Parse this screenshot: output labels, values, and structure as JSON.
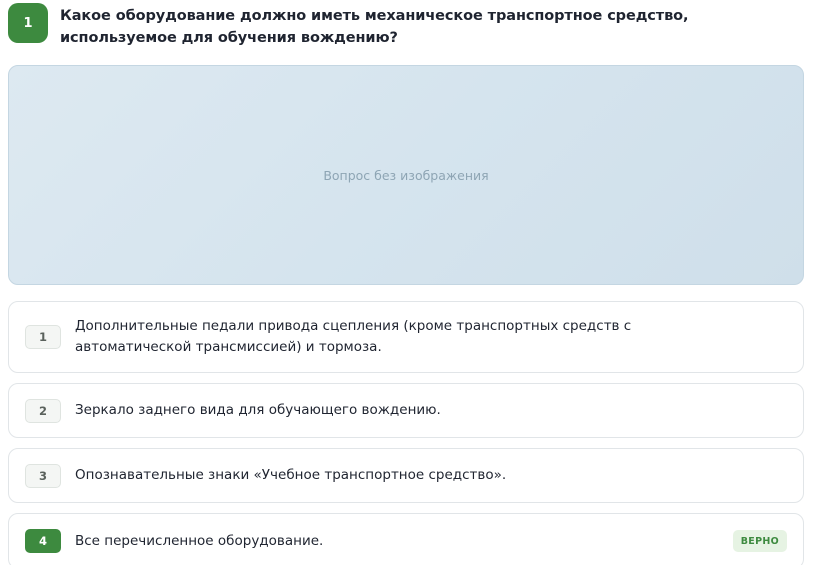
{
  "question": {
    "number": "1",
    "text": "Какое оборудование должно иметь механическое транспортное средство, используемое для обучения вождению?"
  },
  "image": {
    "placeholder": "Вопрос без изображения"
  },
  "answers": [
    {
      "number": "1",
      "text": "Дополнительные педали привода сцепления (кроме транспортных средств с автоматической трансмиссией) и тормоза."
    },
    {
      "number": "2",
      "text": "Зеркало заднего вида для обучающего вождению."
    },
    {
      "number": "3",
      "text": "Опознавательные знаки «Учебное транспортное средство»."
    },
    {
      "number": "4",
      "text": "Все перечисленное оборудование.",
      "badge": "ВЕРНО"
    }
  ],
  "colors": {
    "accent_green": "#3d8a3f",
    "badge_bg": "#e6f3e3",
    "image_bg": "#d5e4ee"
  }
}
